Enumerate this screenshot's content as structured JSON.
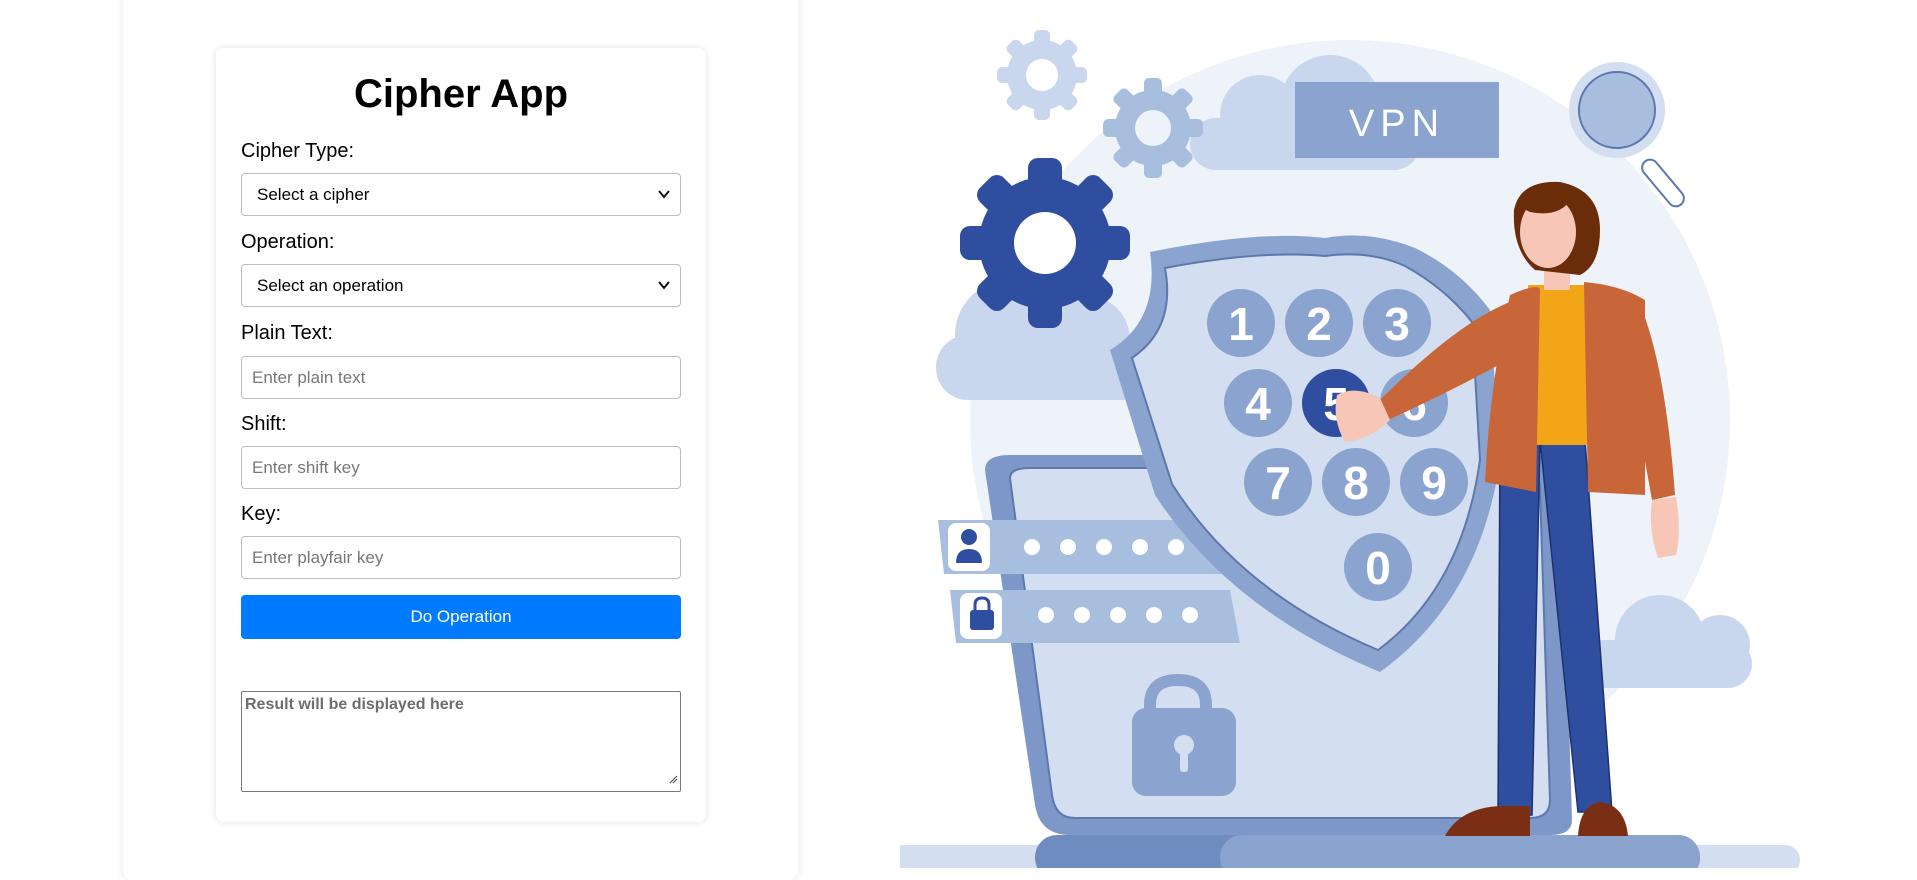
{
  "app": {
    "title": "Cipher App"
  },
  "form": {
    "cipher_type": {
      "label": "Cipher Type:",
      "selected": "Select a cipher"
    },
    "operation": {
      "label": "Operation:",
      "selected": "Select an operation"
    },
    "plain_text": {
      "label": "Plain Text:",
      "placeholder": "Enter plain text"
    },
    "shift": {
      "label": "Shift:",
      "placeholder": "Enter shift key"
    },
    "key": {
      "label": "Key:",
      "placeholder": "Enter playfair key"
    },
    "submit_label": "Do Operation",
    "result_placeholder": "Result will be displayed here"
  },
  "illustration": {
    "sign_text": "VPN",
    "keypad_digits": [
      "1",
      "2",
      "3",
      "4",
      "5",
      "6",
      "7",
      "8",
      "9",
      "0"
    ]
  },
  "colors": {
    "primary_button": "#007bff",
    "illustration_dark_blue": "#2f4ea0",
    "illustration_light_blue": "#8aa4cf",
    "illustration_pale": "#d3dff0",
    "jacket": "#c8663a",
    "shirt": "#f2a516"
  },
  "icons": [
    "chevron-down-icon",
    "user-icon",
    "lock-icon",
    "padlock-icon",
    "gear-icon",
    "magnifier-icon",
    "shield-icon",
    "resize-grip-icon"
  ]
}
